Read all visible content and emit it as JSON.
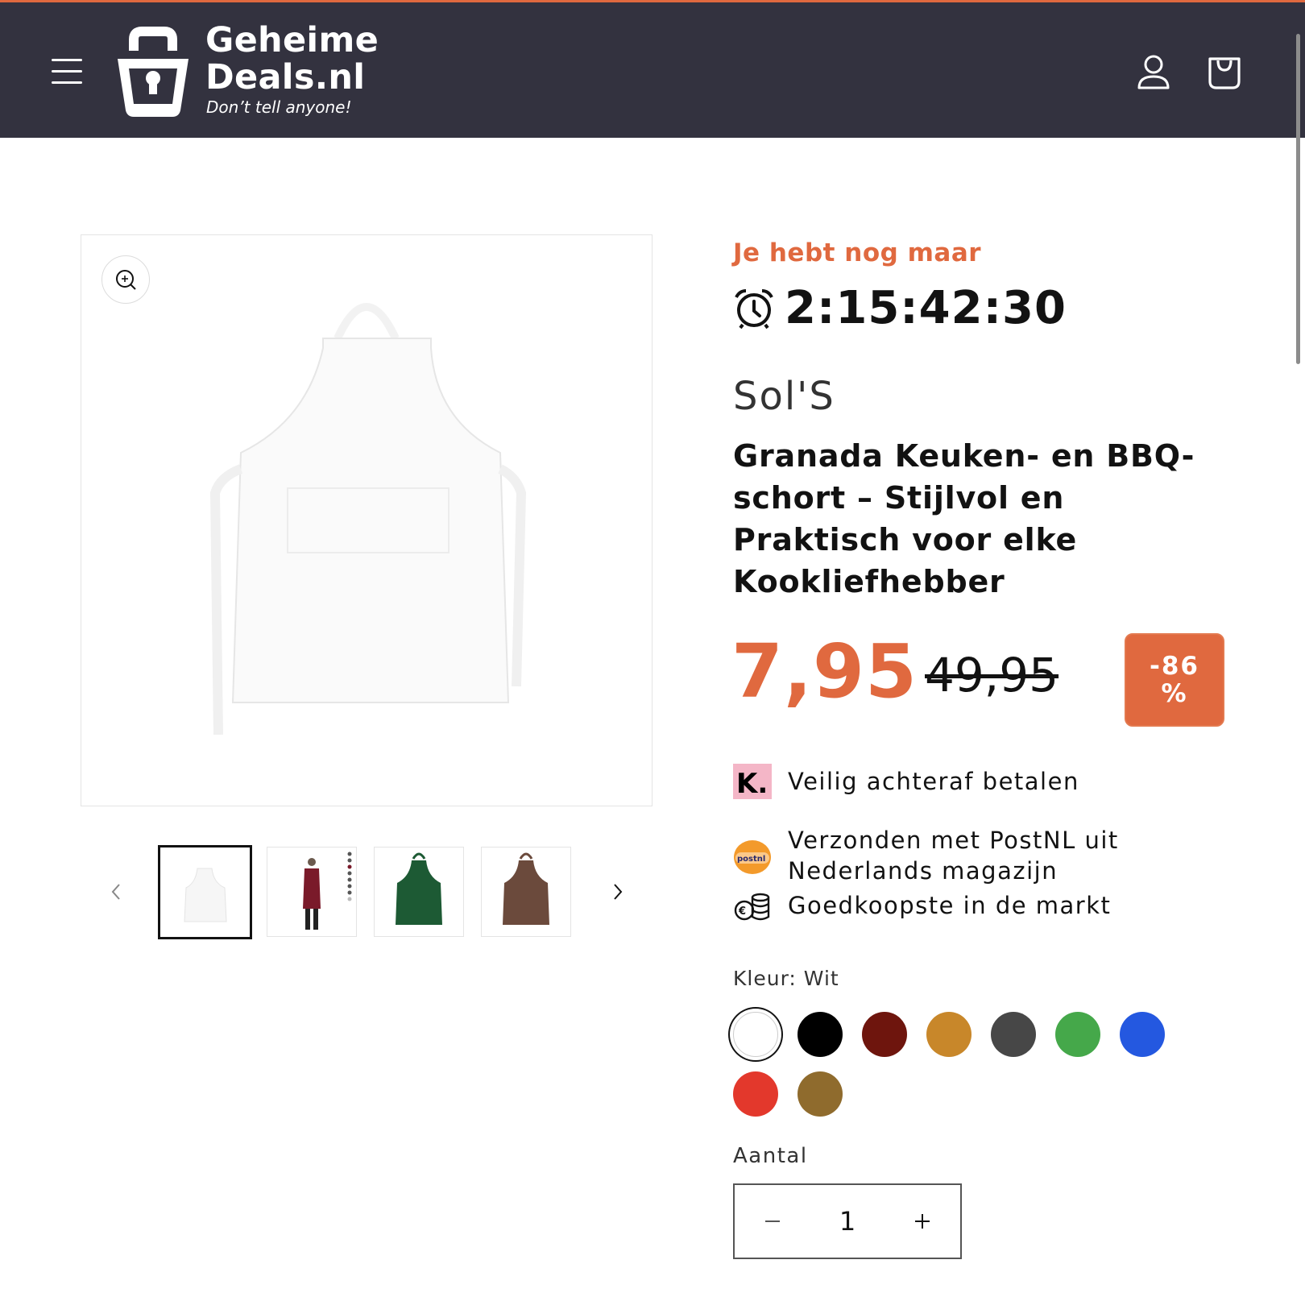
{
  "header": {
    "logo_line1": "Geheime",
    "logo_line2": "Deals.nl",
    "tagline": "Don’t tell anyone!",
    "icons": [
      "menu-icon",
      "account-icon",
      "cart-icon"
    ]
  },
  "product": {
    "urgency_text": "Je hebt nog maar",
    "countdown": "2:15:42:30",
    "vendor": "Sol'S",
    "title": "Granada Keuken- en BBQ-schort – Stijlvol en Praktisch voor elke Kookliefhebber",
    "price": "7,95",
    "compare_price": "49,95",
    "discount_line1": "-86",
    "discount_line2": "%",
    "usps": [
      {
        "icon": "klarna-icon",
        "text": "Veilig achteraf betalen"
      },
      {
        "icon": "postnl-icon",
        "text": "Verzonden met PostNL uit Nederlands magazijn"
      },
      {
        "icon": "coins-icon",
        "text": "Goedkoopste in de markt"
      }
    ],
    "color_label": "Kleur: Wit",
    "colors": [
      "#ffffff",
      "#000000",
      "#6e150d",
      "#c8872a",
      "#474747",
      "#45a84a",
      "#2458e0",
      "#e3382c",
      "#8f6b2d"
    ],
    "selected_color": "#ffffff",
    "quantity_label": "Aantal",
    "quantity_value": "1",
    "thumbnails": [
      "apron-white",
      "apron-model-burgundy",
      "apron-green",
      "apron-brown"
    ],
    "brand_colors": {
      "accent": "#e0693f",
      "header": "#33323f"
    }
  }
}
